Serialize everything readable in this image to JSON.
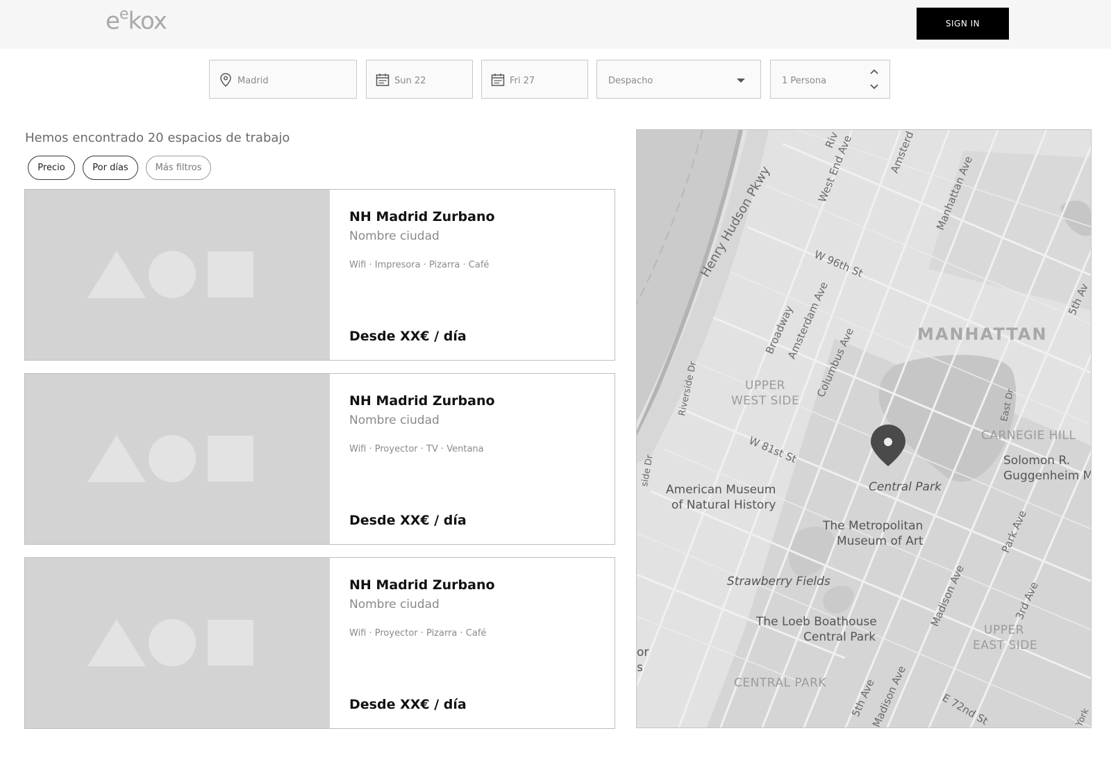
{
  "header": {
    "logo_text": "eekox",
    "signin_label": "SIGN IN"
  },
  "search": {
    "city": "Madrid",
    "date_start": "Sun 22",
    "date_end": "Fri 27",
    "space_type": "Despacho",
    "people": "1 Persona"
  },
  "results": {
    "count_text": "Hemos encontrado 20 espacios de trabajo",
    "filters": [
      "Precio",
      "Por días",
      "Más filtros"
    ]
  },
  "cards": [
    {
      "title": "NH Madrid Zurbano",
      "city": "Nombre ciudad",
      "amenities": "Wifi · Impresora · Pizarra · Café",
      "price": "Desde XX€ / día"
    },
    {
      "title": "NH Madrid Zurbano",
      "city": "Nombre ciudad",
      "amenities": "Wifi · Proyector · TV · Ventana",
      "price": "Desde XX€ / día"
    },
    {
      "title": "NH Madrid Zurbano",
      "city": "Nombre ciudad",
      "amenities": "Wifi · Proyector · Pizarra · Café",
      "price": "Desde XX€ / día"
    }
  ],
  "map": {
    "streets": {
      "henry_hudson": "Henry Hudson Pkwy",
      "west_end": "West End Ave",
      "amsterdam_top": "Amsterd",
      "manhattan_ave": "Manhattan Ave",
      "w96": "W 96th St",
      "broadway": "Broadway",
      "amsterdam": "Amsterdam Ave",
      "columbus": "Columbus Ave",
      "riverside": "Riverside Dr",
      "riverside_left": "side Dr",
      "w81": "W 81st St",
      "fifth_top": "5th Av",
      "east_dr": "East Dr",
      "park_ave": "Park Ave",
      "madison": "Madison Ave",
      "third": "3rd Ave",
      "fifth": "5th Ave",
      "madison_bottom": "Madison Ave",
      "e72": "E 72nd St",
      "york": "York",
      "riv_top": "Riv"
    },
    "areas": {
      "manhattan": "MANHATTAN",
      "uws_1": "UPPER",
      "uws_2": "WEST SIDE",
      "carnegie": "CARNEGIE HILL",
      "ues_1": "UPPER",
      "ues_2": "EAST SIDE",
      "central_park_area": "CENTRAL PARK"
    },
    "pois": {
      "central_park": "Central Park",
      "amnh_1": "American Museum",
      "amnh_2": "of Natural History",
      "met_1": "The Metropolitan",
      "met_2": "Museum of Art",
      "strawberry": "Strawberry Fields",
      "loeb_1": "The Loeb Boathouse",
      "loeb_2": "Central Park",
      "guggenheim_1": "Solomon R.",
      "guggenheim_2": "Guggenheim M",
      "left_edge_1": "or",
      "left_edge_2": "s"
    }
  }
}
